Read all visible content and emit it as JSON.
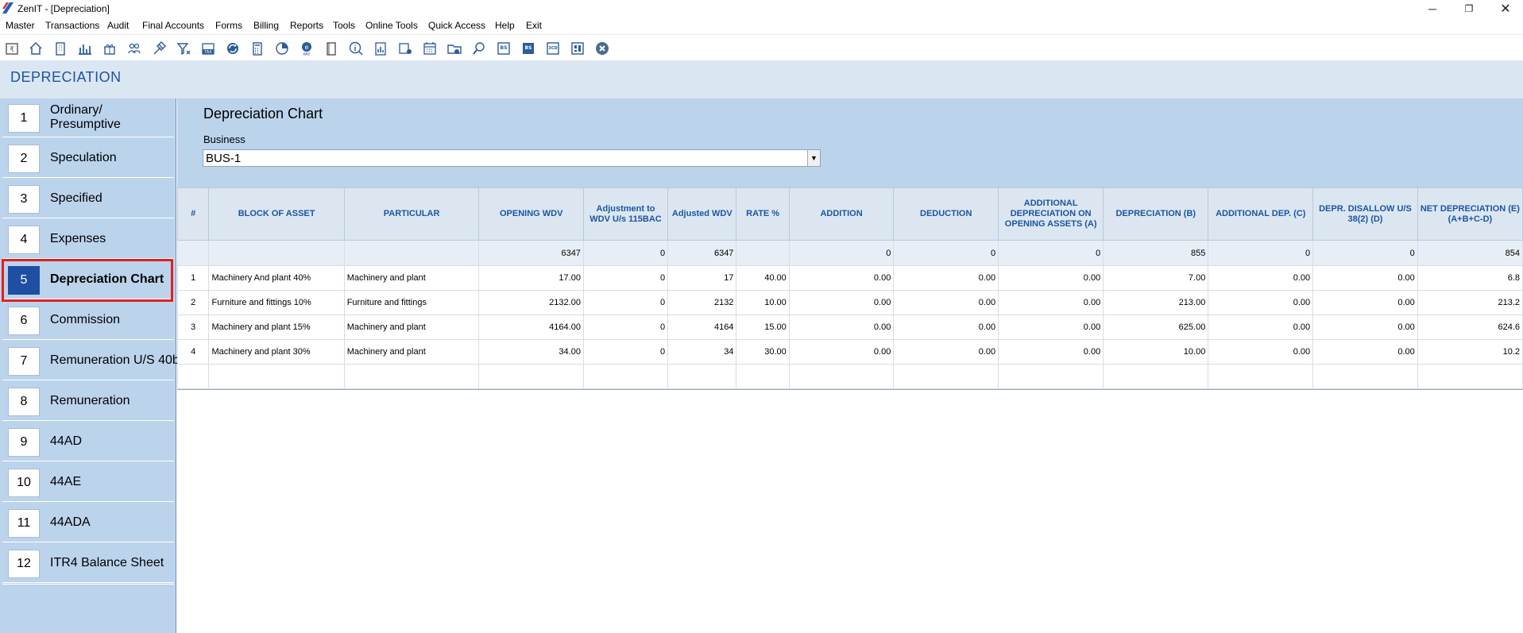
{
  "window": {
    "title": "ZenIT - [Depreciation]",
    "minimize": "─",
    "maximize": "❐",
    "close": "✕"
  },
  "menu": [
    "Master",
    "Transactions",
    "Audit",
    "Final Accounts",
    "Forms",
    "Billing",
    "Reports",
    "Tools",
    "Online Tools",
    "Quick Access",
    "Help",
    "Exit"
  ],
  "toolbar_icons": [
    "rupee-book-icon",
    "home-icon",
    "building-icon",
    "bar-chart-icon",
    "gift-icon",
    "users-icon",
    "hammer-icon",
    "filter-icon",
    "tax-icon",
    "refresh-icon",
    "calculator-icon",
    "pie-chart-icon",
    "e-pay-icon",
    "book-icon",
    "info-icon",
    "report-icon",
    "calendar-user-icon",
    "calendar-icon",
    "folder-icon",
    "search-doc-icon",
    "bs-icon",
    "bs-alt-icon",
    "3cd-icon",
    "dashboard-icon",
    "close-circle-icon"
  ],
  "module": {
    "title": "DEPRECIATION"
  },
  "sidebar": {
    "items": [
      {
        "num": "1",
        "label": "Ordinary/ Presumptive"
      },
      {
        "num": "2",
        "label": "Speculation"
      },
      {
        "num": "3",
        "label": "Specified"
      },
      {
        "num": "4",
        "label": "Expenses"
      },
      {
        "num": "5",
        "label": "Depreciation Chart"
      },
      {
        "num": "6",
        "label": "Commission"
      },
      {
        "num": "7",
        "label": "Remuneration U/S 40b"
      },
      {
        "num": "8",
        "label": "Remuneration"
      },
      {
        "num": "9",
        "label": "44AD"
      },
      {
        "num": "10",
        "label": "44AE"
      },
      {
        "num": "11",
        "label": "44ADA"
      },
      {
        "num": "12",
        "label": "ITR4 Balance Sheet"
      }
    ]
  },
  "main": {
    "title": "Depreciation Chart",
    "business_label": "Business",
    "business_value": "BUS-1",
    "dropdown_arrow": "▼"
  },
  "table": {
    "headers": [
      "#",
      "BLOCK OF ASSET",
      "PARTICULAR",
      "OPENING WDV",
      "Adjustment to WDV U/s 115BAC",
      "Adjusted WDV",
      "RATE %",
      "ADDITION",
      "DEDUCTION",
      "ADDITIONAL DEPRECIATION ON OPENING ASSETS (A)",
      "DEPRECIATION (B)",
      "ADDITIONAL DEP. (C)",
      "DEPR. DISALLOW U/S 38(2) (D)",
      "NET DEPRECIATION (E)(A+B+C-D)"
    ],
    "totals": [
      "",
      "",
      "",
      "6347",
      "0",
      "6347",
      "",
      "0",
      "0",
      "0",
      "855",
      "0",
      "0",
      "854"
    ],
    "rows": [
      [
        "1",
        "Machinery And plant 40%",
        "Machinery and plant",
        "17.00",
        "0",
        "17",
        "40.00",
        "0.00",
        "0.00",
        "0.00",
        "7.00",
        "0.00",
        "0.00",
        "6.8"
      ],
      [
        "2",
        "Furniture and fittings 10%",
        "Furniture and fittings",
        "2132.00",
        "0",
        "2132",
        "10.00",
        "0.00",
        "0.00",
        "0.00",
        "213.00",
        "0.00",
        "0.00",
        "213.2"
      ],
      [
        "3",
        "Machinery and plant 15%",
        "Machinery and plant",
        "4164.00",
        "0",
        "4164",
        "15.00",
        "0.00",
        "0.00",
        "0.00",
        "625.00",
        "0.00",
        "0.00",
        "624.6"
      ],
      [
        "4",
        "Machinery and plant 30%",
        "Machinery and plant",
        "34.00",
        "0",
        "34",
        "30.00",
        "0.00",
        "0.00",
        "0.00",
        "10.00",
        "0.00",
        "0.00",
        "10.2"
      ]
    ]
  }
}
